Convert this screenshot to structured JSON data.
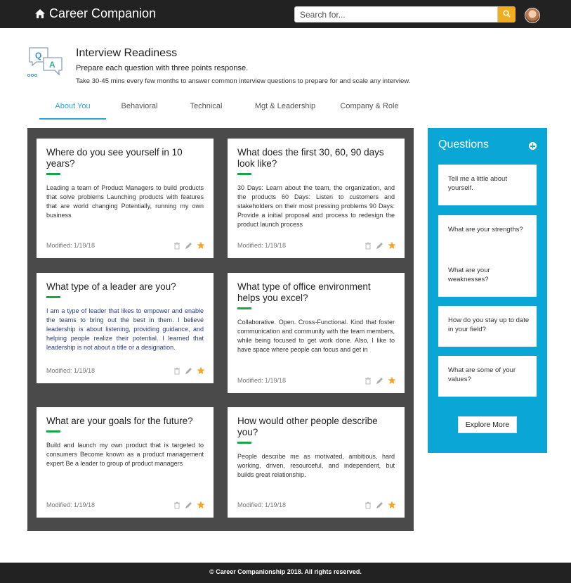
{
  "nav": {
    "brand": "Career Companion",
    "search_placeholder": "Search for...",
    "icons": [
      "home-icon",
      "search-icon",
      "avatar"
    ]
  },
  "header": {
    "title": "Interview Readiness",
    "subtitle": "Prepare each question with three points response.",
    "description": "Take 30-45 mins every few months to answer common interview questions to prepare for and scale any interview.",
    "logo_letters": [
      "Q",
      "A"
    ]
  },
  "tabs": [
    {
      "label": "About You",
      "active": true
    },
    {
      "label": "Behavioral",
      "active": false
    },
    {
      "label": "Technical",
      "active": false
    },
    {
      "label": "Mgt & Leadership",
      "active": false
    },
    {
      "label": "Company & Role",
      "active": false
    }
  ],
  "cards": [
    {
      "title": "Where do you see yourself in 10 years?",
      "answer": "Leading a team of Product Managers to build products that solve problems Launching products with features that are world changing Potentially, running my own business",
      "modified": "Modified: 1/19/18",
      "favorite": true
    },
    {
      "title": "What does the first 30, 60, 90 days look like?",
      "answer": "30 Days: Learn about the team, the organization, and the products 60 Days: Listen to customers and stakeholders on their most pressing problems 90 Days: Provide a initial proposal and process to redesign the product launch process",
      "modified": "Modified: 1/19/18",
      "favorite": true
    },
    {
      "title": "What type of a leader are you?",
      "answer": "I am a type of leader that likes to empower and enable the teams to bring out the best in them. I believe leadership is about listening, providing guidance, and helping people realize their potential. I learned that leadership is not about a title or a designation.",
      "modified": "Modified: 1/19/18",
      "favorite": true
    },
    {
      "title": "What type of office environment helps you excel?",
      "answer": "Collaborative. Open. Cross-Functional. Kind that foster communication and community with the team members, while being focused to get work done. Also, I like to have space where people can focus and get in",
      "modified": "Modified: 1/19/18",
      "favorite": true
    },
    {
      "title": "What are your goals for the future?",
      "answer": "Build and launch my own product that is targeted to consumers Become known as a product management expert Be a leader to group of product managers",
      "modified": "Modified: 1/19/18",
      "favorite": true
    },
    {
      "title": "How would other people describe you?",
      "answer": "People describe me as motivated, ambitious, hard working, driven, resourceful, and independent, but builds great relationship.",
      "modified": "Modified: 1/19/18",
      "favorite": true
    }
  ],
  "questions_panel": {
    "heading": "Questions",
    "items": [
      "Tell me a little about yourself.",
      "What are your strengths?",
      "What are your weaknesses?",
      "How do you stay up to date in your field?",
      "What are some of your values?"
    ],
    "explore_label": "Explore More"
  },
  "footer": {
    "text": "© Career Companionship 2018. All rights reserved."
  },
  "colors": {
    "topbar": "#222222",
    "accent_blue": "#0aa7d6",
    "tab_active": "#2aa6d8",
    "green_bar": "#1aa54a",
    "star": "#f5a623",
    "search_button": "#f0ad1e",
    "board": "#4a4a4a"
  }
}
